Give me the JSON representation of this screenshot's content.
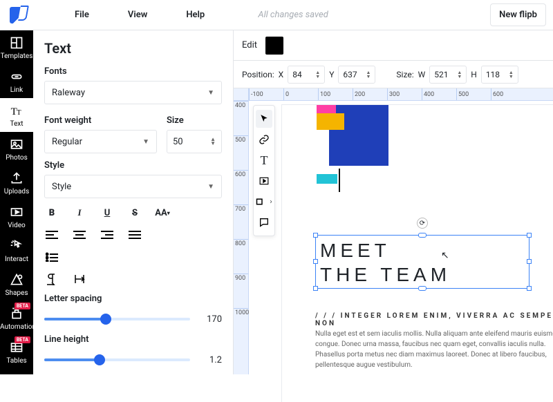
{
  "menubar": {
    "items": [
      "File",
      "View",
      "Help"
    ],
    "status": "All changes saved",
    "new_button": "New flipb"
  },
  "rail": {
    "items": [
      {
        "label": "Templates"
      },
      {
        "label": "Link"
      },
      {
        "label": "Text"
      },
      {
        "label": "Photos"
      },
      {
        "label": "Uploads"
      },
      {
        "label": "Video"
      },
      {
        "label": "Interact"
      },
      {
        "label": "Shapes"
      },
      {
        "label": "Automation",
        "badge": "BETA"
      },
      {
        "label": "Tables",
        "badge": "BETA"
      }
    ]
  },
  "panel": {
    "title": "Text",
    "fonts_label": "Fonts",
    "font_value": "Raleway",
    "weight_label": "Font weight",
    "weight_value": "Regular",
    "size_label": "Size",
    "size_value": "50",
    "style_label": "Style",
    "style_value": "Style",
    "letter_label": "Letter spacing",
    "letter_value": "170",
    "line_label": "Line height",
    "line_value": "1.2"
  },
  "stage": {
    "edit_label": "Edit",
    "pos_label": "Position:",
    "x_label": "X",
    "x": "84",
    "y_label": "Y",
    "y": "637",
    "size_label": "Size:",
    "w_label": "W",
    "w": "521",
    "h_label": "H",
    "h": "118"
  },
  "ruler_h": [
    "-100",
    "0",
    "100",
    "200",
    "300",
    "400",
    "500",
    "600"
  ],
  "ruler_v": [
    "400",
    "500",
    "600",
    "700",
    "800",
    "900",
    "1000"
  ],
  "canvas": {
    "headline_l1": "MEET",
    "headline_l2": "THE TEAM",
    "tagline": "/ / / INTEGER LOREM ENIM, VIVERRA AC SEMPER NON",
    "body": "Nulla eget est et sem iaculis mollis. Nulla aliquam ante eleifend mauris euismod congue. Donec urna massa, faucibus nec quam eget, convallis iaculis nulla. Phasellus porta metus nec diam maximus laoreet. Donec at libero faucibus, pellentesque augue vestibulum."
  }
}
